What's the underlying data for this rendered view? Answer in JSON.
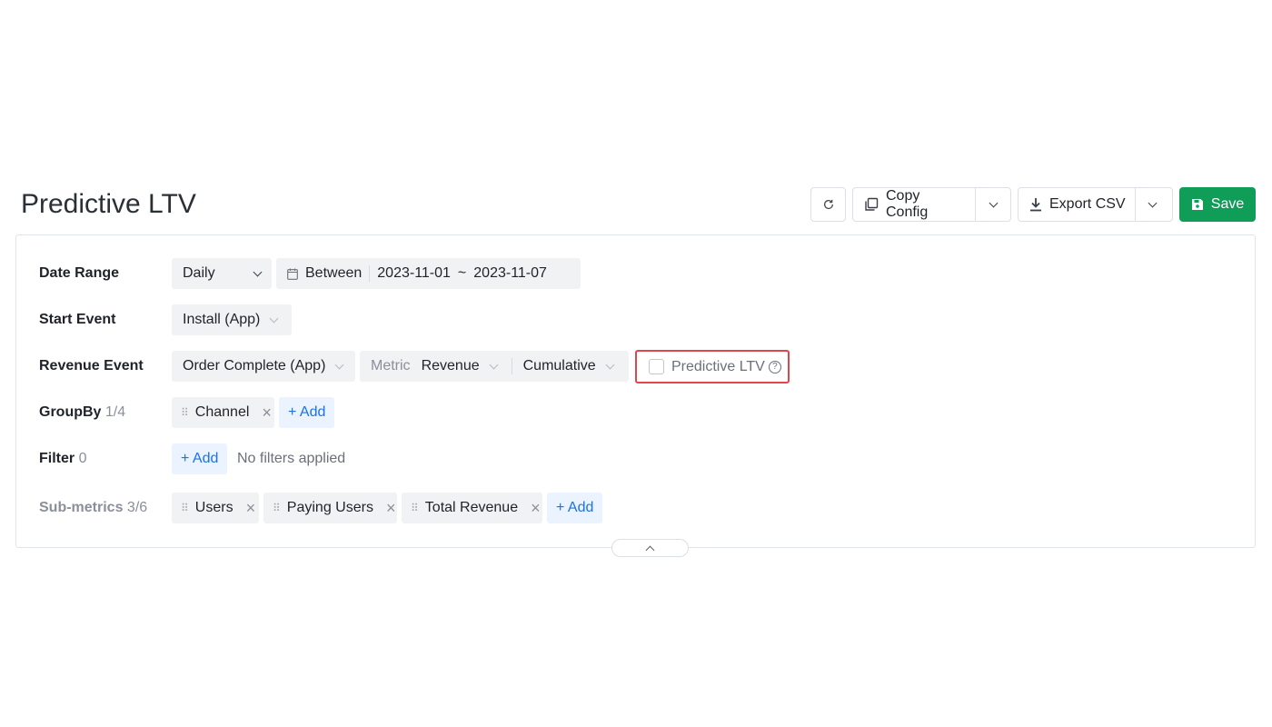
{
  "page": {
    "title": "Predictive LTV"
  },
  "toolbar": {
    "refresh_icon": "refresh-icon",
    "copy_config_label": "Copy Config",
    "export_csv_label": "Export CSV",
    "save_label": "Save",
    "save_color": "#0f9d58"
  },
  "date_range": {
    "label": "Date Range",
    "granularity": "Daily",
    "mode": "Between",
    "start": "2023-11-01",
    "separator": "~",
    "end": "2023-11-07"
  },
  "start_event": {
    "label": "Start Event",
    "value": "Install (App)"
  },
  "revenue_event": {
    "label": "Revenue Event",
    "event": "Order Complete (App)",
    "metric_label": "Metric",
    "metric": "Revenue",
    "aggregation": "Cumulative",
    "predictive_ltv_label": "Predictive LTV",
    "predictive_ltv_checked": false,
    "highlight_color": "#e0474c"
  },
  "groupby": {
    "label": "GroupBy",
    "count": "1/4",
    "items": [
      {
        "label": "Channel"
      }
    ],
    "add_label": "+ Add"
  },
  "filter": {
    "label": "Filter",
    "count": "0",
    "add_label": "+ Add",
    "empty_text": "No filters applied"
  },
  "sub_metrics": {
    "label": "Sub-metrics",
    "count": "3/6",
    "items": [
      {
        "label": "Users"
      },
      {
        "label": "Paying Users"
      },
      {
        "label": "Total Revenue"
      }
    ],
    "add_label": "+ Add"
  }
}
